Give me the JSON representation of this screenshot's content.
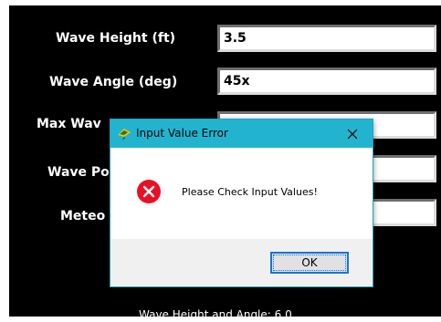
{
  "form": {
    "fields": [
      {
        "label": "Wave Height (ft)",
        "value": "3.5"
      },
      {
        "label": "Wave Angle (deg)",
        "value": "45x"
      },
      {
        "label": "Max Wav",
        "value": ""
      },
      {
        "label": "Wave Po",
        "value": ""
      },
      {
        "label": "Meteo",
        "value": ""
      }
    ],
    "footer_text": "Wave Height and Angle: 6.0"
  },
  "dialog": {
    "title": "Input Value Error",
    "message": "Please Check Input Values!",
    "ok_label": "OK",
    "close_glyph": "✕",
    "icons": {
      "app": "app-icon",
      "error": "error-icon",
      "close": "close-icon"
    }
  },
  "colors": {
    "app_background": "#000000",
    "dialog_titlebar": "#22b4cf",
    "error_red": "#e81123",
    "button_focus": "#1a73d9"
  }
}
